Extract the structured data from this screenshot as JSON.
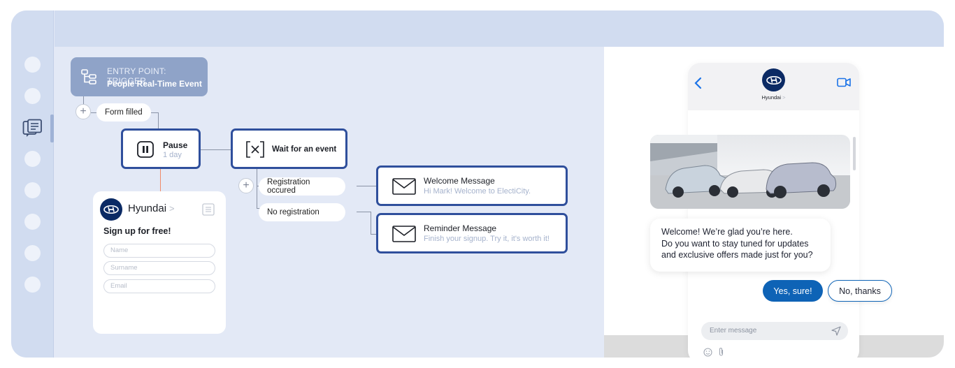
{
  "trigger": {
    "title": "ENTRY POINT: TRIGGER",
    "subtitle": "People Real-Time Event",
    "icon": "flow-tree-icon"
  },
  "flow": {
    "form_filled": "Form filled",
    "pause": {
      "title": "Pause",
      "sub": "1 day"
    },
    "wait": {
      "title": "Wait for an event"
    },
    "registration_occured": "Registration occured",
    "no_registration": "No registration",
    "welcome": {
      "title": "Welcome Message",
      "sub": "Hi Mark! Welcome to ElectiCity."
    },
    "reminder": {
      "title": "Reminder Message",
      "sub": "Finish your signup. Try it, it's worth it!"
    }
  },
  "form": {
    "brand": "Hyundai",
    "chevron": ">",
    "heading": "Sign up for free!",
    "fields": [
      "Name",
      "Surname",
      "Email"
    ]
  },
  "chat": {
    "brand": "Hyundai",
    "brand_chevron": ">",
    "message": [
      "Welcome! We’re glad you’re here.",
      "Do you want to stay tuned for updates",
      "and exclusive offers made just for you?"
    ],
    "yes": "Yes, sure!",
    "no": "No, thanks",
    "input_placeholder": "Enter message"
  },
  "colors": {
    "node_border": "#2f4f9c",
    "accent_blue": "#0e63b6",
    "trigger_bg": "#8fa3c8",
    "orange_link": "#f08a68"
  }
}
